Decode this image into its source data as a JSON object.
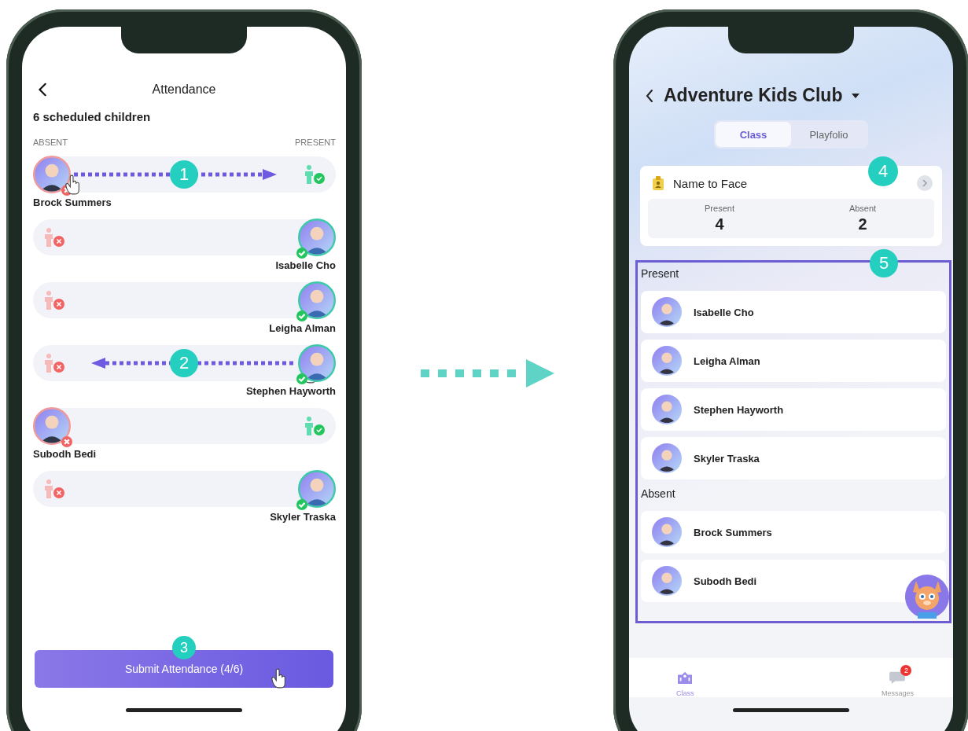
{
  "attendance_screen": {
    "title": "Attendance",
    "subtitle": "6 scheduled children",
    "absent_label": "ABSENT",
    "present_label": "PRESENT",
    "children": [
      {
        "name": "Brock Summers",
        "present": false,
        "annotation": {
          "kind": "swipe-right",
          "step": "1"
        }
      },
      {
        "name": "Isabelle Cho",
        "present": true
      },
      {
        "name": "Leigha Alman",
        "present": true
      },
      {
        "name": "Stephen Hayworth",
        "present": true,
        "annotation": {
          "kind": "swipe-left",
          "step": "2"
        }
      },
      {
        "name": "Subodh Bedi",
        "present": false
      },
      {
        "name": "Skyler Traska",
        "present": true
      }
    ],
    "submit": {
      "label": "Submit Attendance (4/6)",
      "step": "3"
    }
  },
  "class_screen": {
    "title": "Adventure Kids Club",
    "tabs": [
      {
        "label": "Class",
        "selected": true
      },
      {
        "label": "Playfolio",
        "selected": false
      }
    ],
    "summary": {
      "title": "Name to Face",
      "step": "4",
      "stats": [
        {
          "label": "Present",
          "value": "4"
        },
        {
          "label": "Absent",
          "value": "2"
        }
      ]
    },
    "roster": {
      "step": "5",
      "groups": [
        {
          "heading": "Present",
          "children": [
            "Isabelle Cho",
            "Leigha Alman",
            "Stephen Hayworth",
            "Skyler Traska"
          ]
        },
        {
          "heading": "Absent",
          "children": [
            "Brock Summers",
            "Subodh Bedi"
          ]
        }
      ]
    },
    "nav": [
      {
        "kind": "class",
        "label": "Class",
        "selected": true
      },
      {
        "kind": "messages",
        "label": "Messages",
        "selected": false,
        "badge": "2"
      }
    ]
  }
}
